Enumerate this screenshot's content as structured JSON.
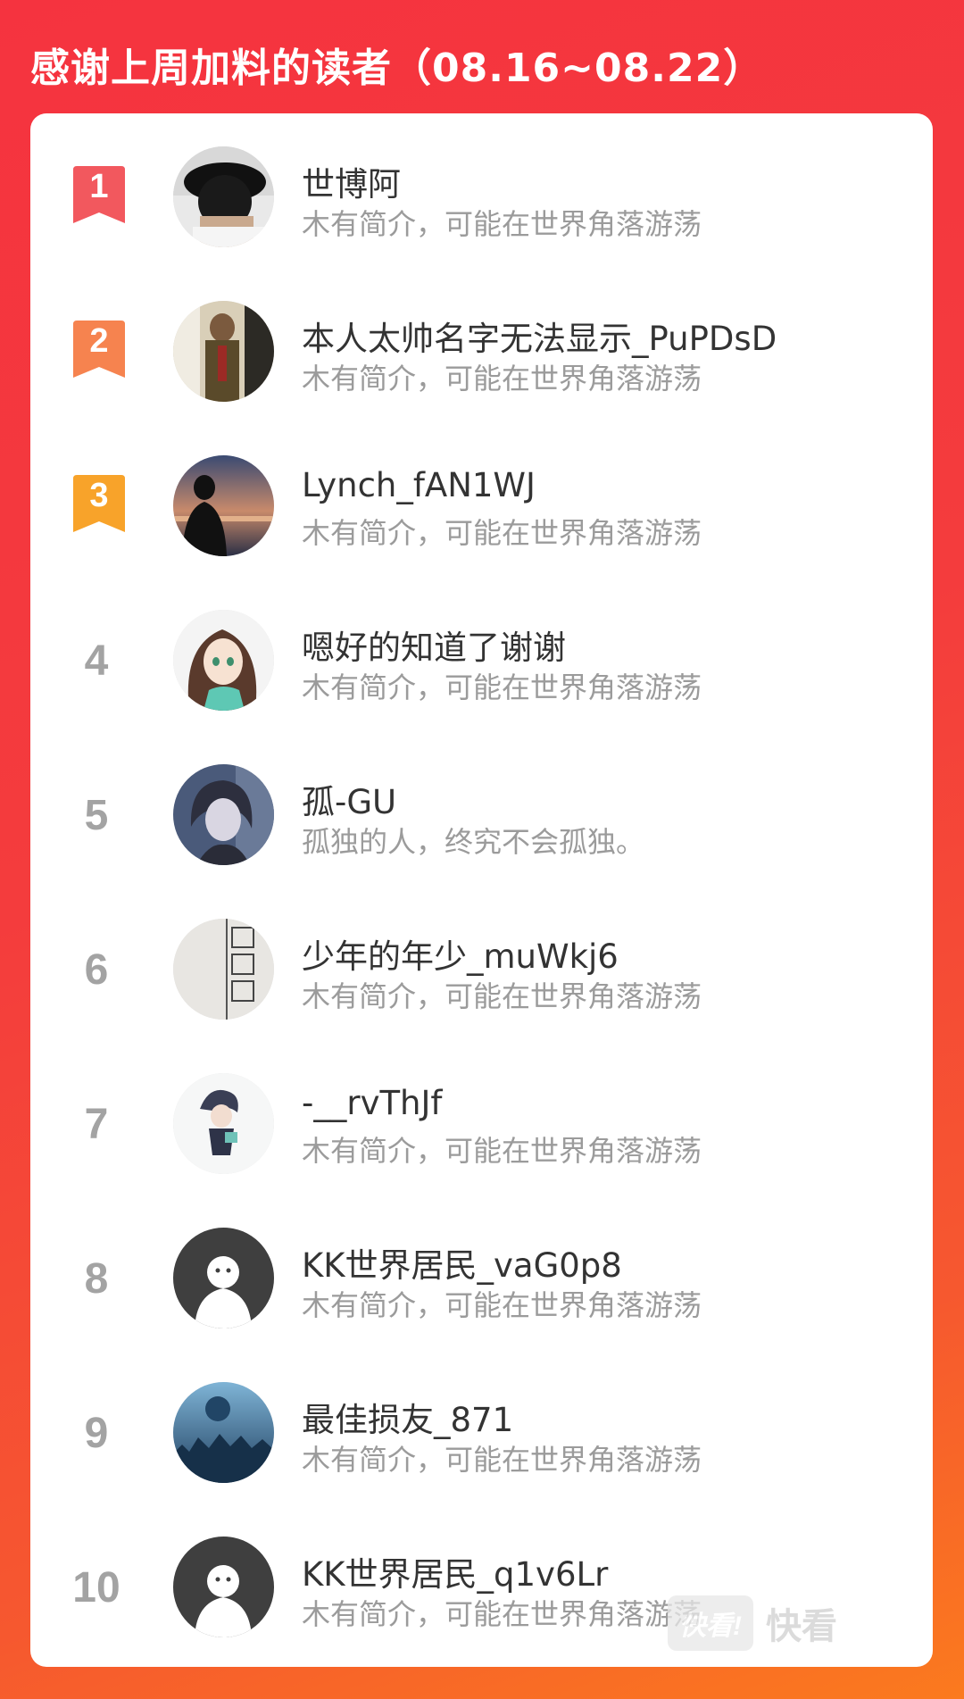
{
  "header": {
    "title": "感谢上周加料的读者（08.16~08.22）"
  },
  "colors": {
    "rank1": "#f2585e",
    "rank2": "#f6834f",
    "rank3": "#f8a32a"
  },
  "readers": [
    {
      "rank": "1",
      "name": "世博阿",
      "bio": "木有简介，可能在世界角落游荡"
    },
    {
      "rank": "2",
      "name": "本人太帅名字无法显示_PuPDsD",
      "bio": "木有简介，可能在世界角落游荡"
    },
    {
      "rank": "3",
      "name": "Lynch_fAN1WJ",
      "bio": "木有简介，可能在世界角落游荡"
    },
    {
      "rank": "4",
      "name": "嗯好的知道了谢谢",
      "bio": "木有简介，可能在世界角落游荡"
    },
    {
      "rank": "5",
      "name": "孤-GU",
      "bio": "孤独的人，终究不会孤独。"
    },
    {
      "rank": "6",
      "name": "少年的年少_muWkj6",
      "bio": "木有简介，可能在世界角落游荡"
    },
    {
      "rank": "7",
      "name": "-__rvThJf",
      "bio": "木有简介，可能在世界角落游荡"
    },
    {
      "rank": "8",
      "name": "KK世界居民_vaG0p8",
      "bio": "木有简介，可能在世界角落游荡"
    },
    {
      "rank": "9",
      "name": "最佳损友_871",
      "bio": "木有简介，可能在世界角落游荡"
    },
    {
      "rank": "10",
      "name": "KK世界居民_q1v6Lr",
      "bio": "木有简介，可能在世界角落游荡"
    }
  ],
  "watermark": {
    "logo_text": "快看!",
    "text": "快看"
  }
}
